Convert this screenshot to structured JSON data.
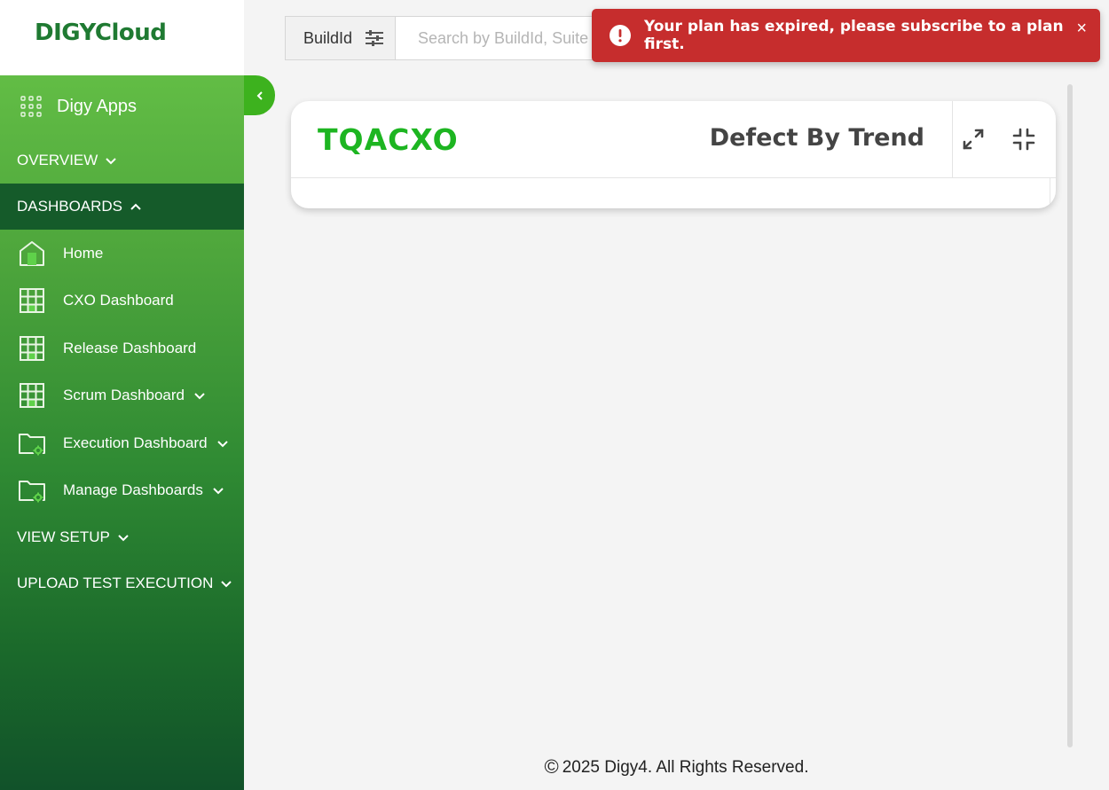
{
  "logo": "DIGYCloud",
  "search": {
    "filter_label": "BuildId",
    "placeholder": "Search by BuildId, Suite"
  },
  "sidebar": {
    "apps_label": "Digy Apps",
    "sections": {
      "overview": "OVERVIEW",
      "dashboards": "DASHBOARDS",
      "view_setup": "VIEW SETUP",
      "upload": "UPLOAD TEST EXECUTION"
    },
    "items": [
      {
        "label": "Home",
        "icon": "home-icon"
      },
      {
        "label": "CXO Dashboard",
        "icon": "grid-table-icon"
      },
      {
        "label": "Release Dashboard",
        "icon": "grid-table-icon"
      },
      {
        "label": "Scrum Dashboard",
        "icon": "grid-table-icon"
      },
      {
        "label": "Execution Dashboard",
        "icon": "folder-gear-icon"
      },
      {
        "label": "Manage Dashboards",
        "icon": "folder-gear-icon"
      }
    ]
  },
  "card": {
    "brand": "TQACXO",
    "title": "Defect By Trend"
  },
  "toast": {
    "message": "Your plan has expired, please subscribe to a plan first.",
    "close": "×"
  },
  "footer": {
    "copy_symbol": "©",
    "text": "2025 Digy4. All Rights Reserved."
  },
  "colors": {
    "brand_green": "#1db521",
    "sidebar_active": "#155b2a",
    "toast_red": "#c62d2d"
  }
}
